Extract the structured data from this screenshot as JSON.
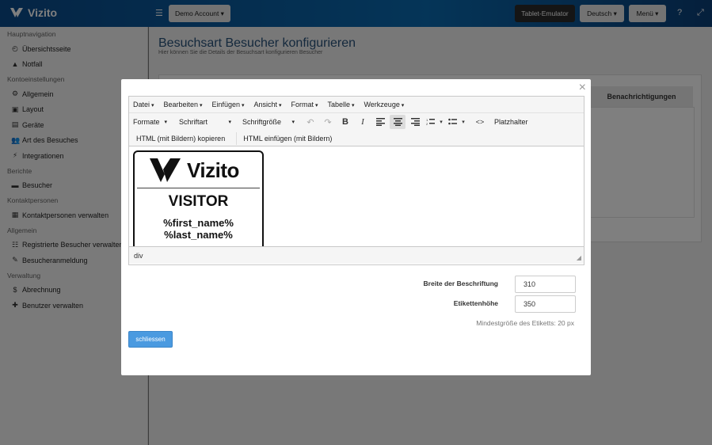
{
  "header": {
    "logo_text": "Vizito",
    "account_label": "Demo Account",
    "tablet_label": "Tablet-Emulator",
    "language_label": "Deutsch",
    "menu_label": "Menü"
  },
  "sidebar": {
    "sections": [
      {
        "title": "Hauptnavigation",
        "items": [
          {
            "label": "Übersichtsseite",
            "icon": "dashboard-icon"
          },
          {
            "label": "Notfall",
            "icon": "warning-icon"
          }
        ]
      },
      {
        "title": "Kontoeinstellungen",
        "items": [
          {
            "label": "Allgemein",
            "icon": "gear-icon"
          },
          {
            "label": "Layout",
            "icon": "image-icon"
          },
          {
            "label": "Geräte",
            "icon": "tablet-icon"
          },
          {
            "label": "Art des Besuches",
            "icon": "users-icon"
          },
          {
            "label": "Integrationen",
            "icon": "plug-icon"
          }
        ]
      },
      {
        "title": "Berichte",
        "items": [
          {
            "label": "Besucher",
            "icon": "book-icon"
          }
        ]
      },
      {
        "title": "Kontaktpersonen",
        "items": [
          {
            "label": "Kontaktpersonen verwalten",
            "icon": "contact-icon"
          }
        ]
      },
      {
        "title": "Allgemein",
        "items": [
          {
            "label": "Registrierte Besucher verwalten",
            "icon": "registered-icon"
          },
          {
            "label": "Besucheranmeldung",
            "icon": "pencil-icon"
          }
        ]
      },
      {
        "title": "Verwaltung",
        "items": [
          {
            "label": "Abrechnung",
            "icon": "dollar-icon"
          },
          {
            "label": "Benutzer verwalten",
            "icon": "user-plus-icon"
          }
        ]
      }
    ]
  },
  "main": {
    "title": "Besuchsart Besucher konfigurieren",
    "subtitle": "Hier können Sie die Details der Besuchsart konfigurieren Besucher",
    "panel_header": "Benachrichtigungen"
  },
  "modal": {
    "close_symbol": "×",
    "menus": [
      "Datei",
      "Bearbeiten",
      "Einfügen",
      "Ansicht",
      "Format",
      "Tabelle",
      "Werkzeuge"
    ],
    "toolbar": {
      "formats": "Formate",
      "font": "Schriftart",
      "font_size": "Schriftgröße",
      "placeholder": "Platzhalter",
      "copy_html": "HTML (mit Bildern) kopieren",
      "paste_html": "HTML einfügen (mit Bildern)"
    },
    "label_preview": {
      "logo_text": "Vizito",
      "visitor": "VISITOR",
      "first_name": "%first_name%",
      "last_name": "%last_name%"
    },
    "status_path": "div",
    "width_label": "Breite der Beschriftung",
    "width_value": "310",
    "height_label": "Etikettenhöhe",
    "height_value": "350",
    "hint": "Mindestgröße des Etiketts: 20 px",
    "close_button": "schliessen"
  }
}
